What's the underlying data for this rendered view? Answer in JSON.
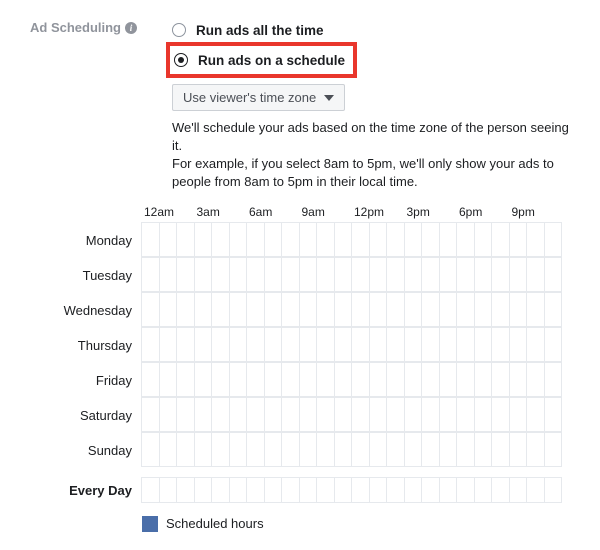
{
  "label": "Ad Scheduling",
  "options": {
    "all_time": "Run ads all the time",
    "on_schedule": "Run ads on a schedule"
  },
  "timezone_selected": "Use viewer's time zone",
  "desc_line1": "We'll schedule your ads based on the time zone of the person seeing it.",
  "desc_line2": "For example, if you select 8am to 5pm, we'll only show your ads to people from 8am to 5pm in their local time.",
  "hours": [
    "12am",
    "3am",
    "6am",
    "9am",
    "12pm",
    "3pm",
    "6pm",
    "9pm"
  ],
  "days": [
    "Monday",
    "Tuesday",
    "Wednesday",
    "Thursday",
    "Friday",
    "Saturday",
    "Sunday"
  ],
  "every_day_label": "Every Day",
  "legend_label": "Scheduled hours"
}
